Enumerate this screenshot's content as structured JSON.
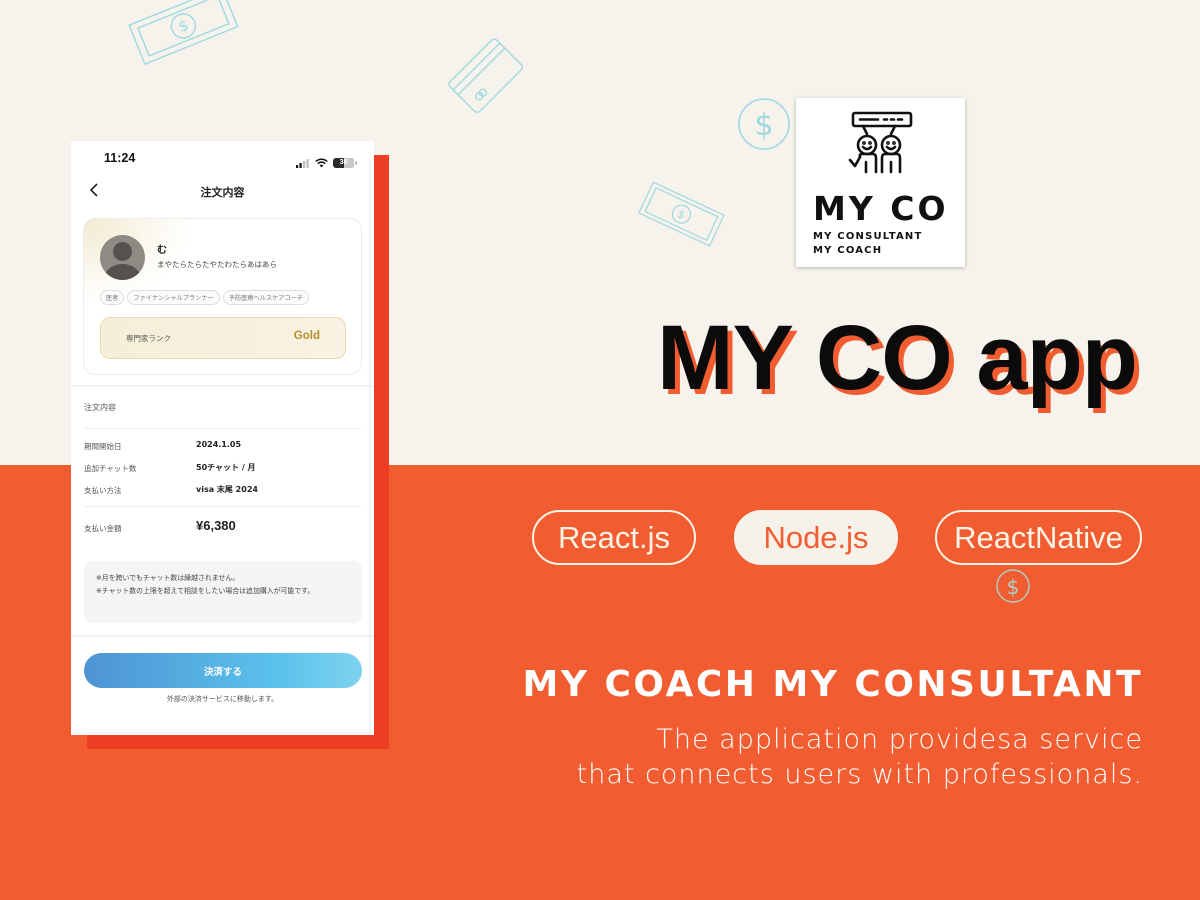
{
  "colors": {
    "cream_bg": "#f6f3ec",
    "orange_bg": "#f15d30",
    "red_shadow": "#ee3d23",
    "gold": "#b7902b",
    "button_gradient_start": "#4e94d3",
    "button_gradient_end": "#7ed3ee",
    "deco_line": "#9fd8e0"
  },
  "phone": {
    "status_bar": {
      "time": "11:24",
      "battery": "38",
      "icons": [
        "signal-icon",
        "wifi-icon",
        "battery-icon"
      ]
    },
    "nav": {
      "back_icon": "chevron-left-icon",
      "title": "注文内容"
    },
    "profile": {
      "name": "む",
      "bio": "まやたらたらたやたわたらあはあら",
      "tags": [
        "医者",
        "ファイナンシャルプランナー",
        "予防医療ヘルスケアコーチ"
      ],
      "rank_label": "専門家ランク",
      "rank_value": "Gold"
    },
    "order": {
      "section_title": "注文内容",
      "rows": [
        {
          "label": "期間開始日",
          "value": "2024.1.05"
        },
        {
          "label": "追加チャット数",
          "value": "50チャット / 月"
        },
        {
          "label": "支払い方法",
          "value": "visa 末尾 2024"
        }
      ],
      "total_label": "支払い金額",
      "total_value": "¥6,380"
    },
    "notice": [
      "※月を跨いでもチャット数は繰越されません。",
      "※チャット数の上限を超えて相談をしたい場合は追加購入が可能です。"
    ],
    "pay_button": "決済する",
    "pay_note": "外部の決済サービスに移動します。"
  },
  "logo": {
    "name": "MY CO",
    "sub_line_1": "MY CONSULTANT",
    "sub_line_2": "MY COACH",
    "icon": "two-people-chat-icon"
  },
  "hero": {
    "title": "MY CO app",
    "tech_pills": [
      {
        "label": "React.js",
        "style": "outline"
      },
      {
        "label": "Node.js",
        "style": "filled"
      },
      {
        "label": "ReactNative",
        "style": "outline"
      }
    ],
    "tagline": "MY COACH MY CONSULTANT",
    "description_line_1": "The application providesa service",
    "description_line_2": "that connects users with professionals."
  },
  "decorations": [
    "banknote-icon",
    "credit-card-icon",
    "dollar-coin-icon",
    "banknote-icon",
    "dollar-coin-icon"
  ]
}
